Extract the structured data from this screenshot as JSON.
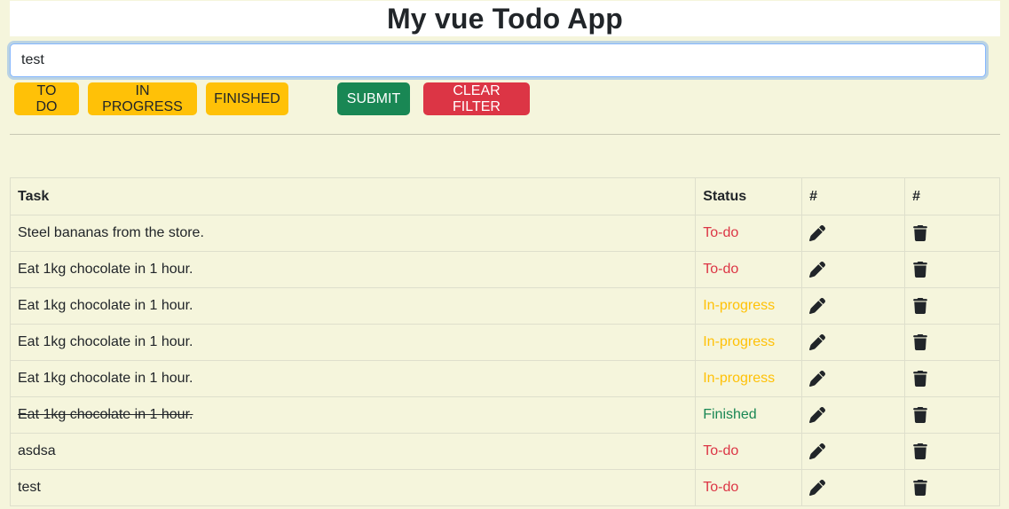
{
  "header": {
    "title": "My vue Todo App"
  },
  "input": {
    "value": "test"
  },
  "buttons": {
    "todo": "TO DO",
    "in_progress": "IN PROGRESS",
    "finished": "FINISHED",
    "submit": "SUBMIT",
    "clear_filter": "CLEAR FILTER"
  },
  "table": {
    "headers": {
      "task": "Task",
      "status": "Status",
      "edit": "#",
      "delete": "#"
    },
    "rows": [
      {
        "task": "Steel bananas from the store.",
        "status": "To-do",
        "finished": false
      },
      {
        "task": "Eat 1kg chocolate in 1 hour.",
        "status": "To-do",
        "finished": false
      },
      {
        "task": "Eat 1kg chocolate in 1 hour.",
        "status": "In-progress",
        "finished": false
      },
      {
        "task": "Eat 1kg chocolate in 1 hour.",
        "status": "In-progress",
        "finished": false
      },
      {
        "task": "Eat 1kg chocolate in 1 hour.",
        "status": "In-progress",
        "finished": false
      },
      {
        "task": "Eat 1kg chocolate in 1 hour.",
        "status": "Finished",
        "finished": true
      },
      {
        "task": "asdsa",
        "status": "To-do",
        "finished": false
      },
      {
        "task": "test",
        "status": "To-do",
        "finished": false
      }
    ]
  },
  "colors": {
    "background": "#f5f5dc",
    "todo": "#dc3545",
    "in_progress": "#ffc107",
    "finished": "#198754",
    "warning_button": "#ffc107",
    "success_button": "#198754",
    "danger_button": "#dc3545"
  },
  "icons": {
    "edit": "pencil-icon",
    "delete": "trash-icon"
  }
}
